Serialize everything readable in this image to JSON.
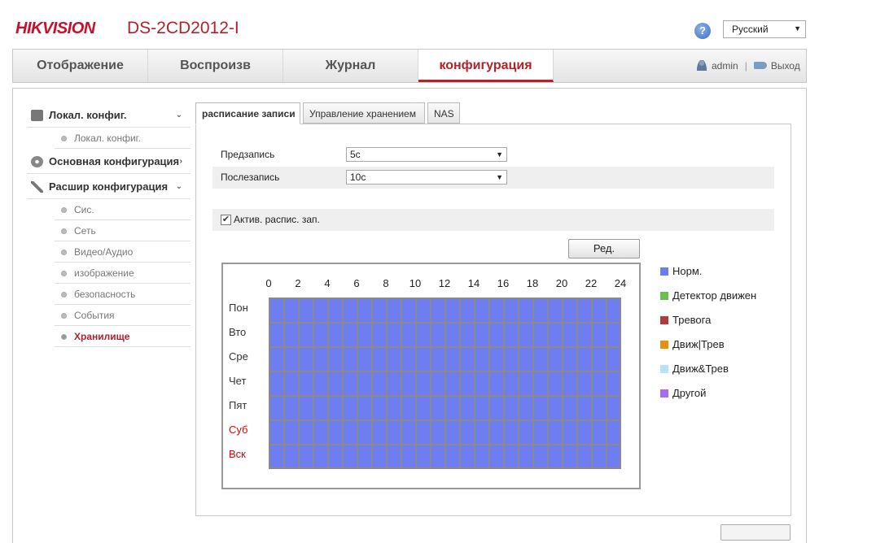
{
  "header": {
    "brand": "HIKVISION",
    "model": "DS-2CD2012-I",
    "help_icon": "?",
    "language": "Русский"
  },
  "nav": {
    "tabs": [
      "Отображение",
      "Воспроизв",
      "Журнал",
      "конфигурация"
    ],
    "active": 3,
    "user": "admin",
    "separator": "|",
    "logout": "Выход"
  },
  "sidebar": {
    "groups": [
      {
        "label": "Локал. конфиг.",
        "icon": "monitor-icon",
        "chevron": "⌄",
        "items": [
          "Локал. конфиг."
        ]
      },
      {
        "label": "Основная конфигурация",
        "icon": "gear-icon",
        "chevron": "›",
        "items": []
      },
      {
        "label": "Расшир конфигурация",
        "icon": "wrench-icon",
        "chevron": "⌄",
        "items": [
          "Сис.",
          "Сеть",
          "Видео/Аудио",
          "изображение",
          "безопасность",
          "События",
          "Хранилище"
        ]
      }
    ],
    "active_item": "Хранилище"
  },
  "page_tabs": [
    "расписание записи",
    "Управление хранением",
    "NAS"
  ],
  "form": {
    "prerecord_label": "Предзапись",
    "prerecord_value": "5с",
    "postrecord_label": "Послезапись",
    "postrecord_value": "10с",
    "enable_label": "Актив. распис. зап.",
    "enable_checked": true
  },
  "edit_button": "Ред.",
  "schedule": {
    "hours": [
      "0",
      "2",
      "4",
      "6",
      "8",
      "10",
      "12",
      "14",
      "16",
      "18",
      "20",
      "22",
      "24"
    ],
    "days": [
      "Пон",
      "Вто",
      "Сре",
      "Чет",
      "Пят",
      "Суб",
      "Вск"
    ],
    "weekend_days": [
      "Суб",
      "Вск"
    ]
  },
  "legend": [
    {
      "label": "Норм.",
      "color": "#6e7ef1"
    },
    {
      "label": "Детектор движен",
      "color": "#6abf4b"
    },
    {
      "label": "Тревога",
      "color": "#b33a3a"
    },
    {
      "label": "Движ|Трев",
      "color": "#e8900c"
    },
    {
      "label": "Движ&Трев",
      "color": "#b7e2f7"
    },
    {
      "label": "Другой",
      "color": "#a86bf0"
    }
  ],
  "colors": {
    "accent": "#b0232a",
    "normal": "#6e7ef1"
  }
}
